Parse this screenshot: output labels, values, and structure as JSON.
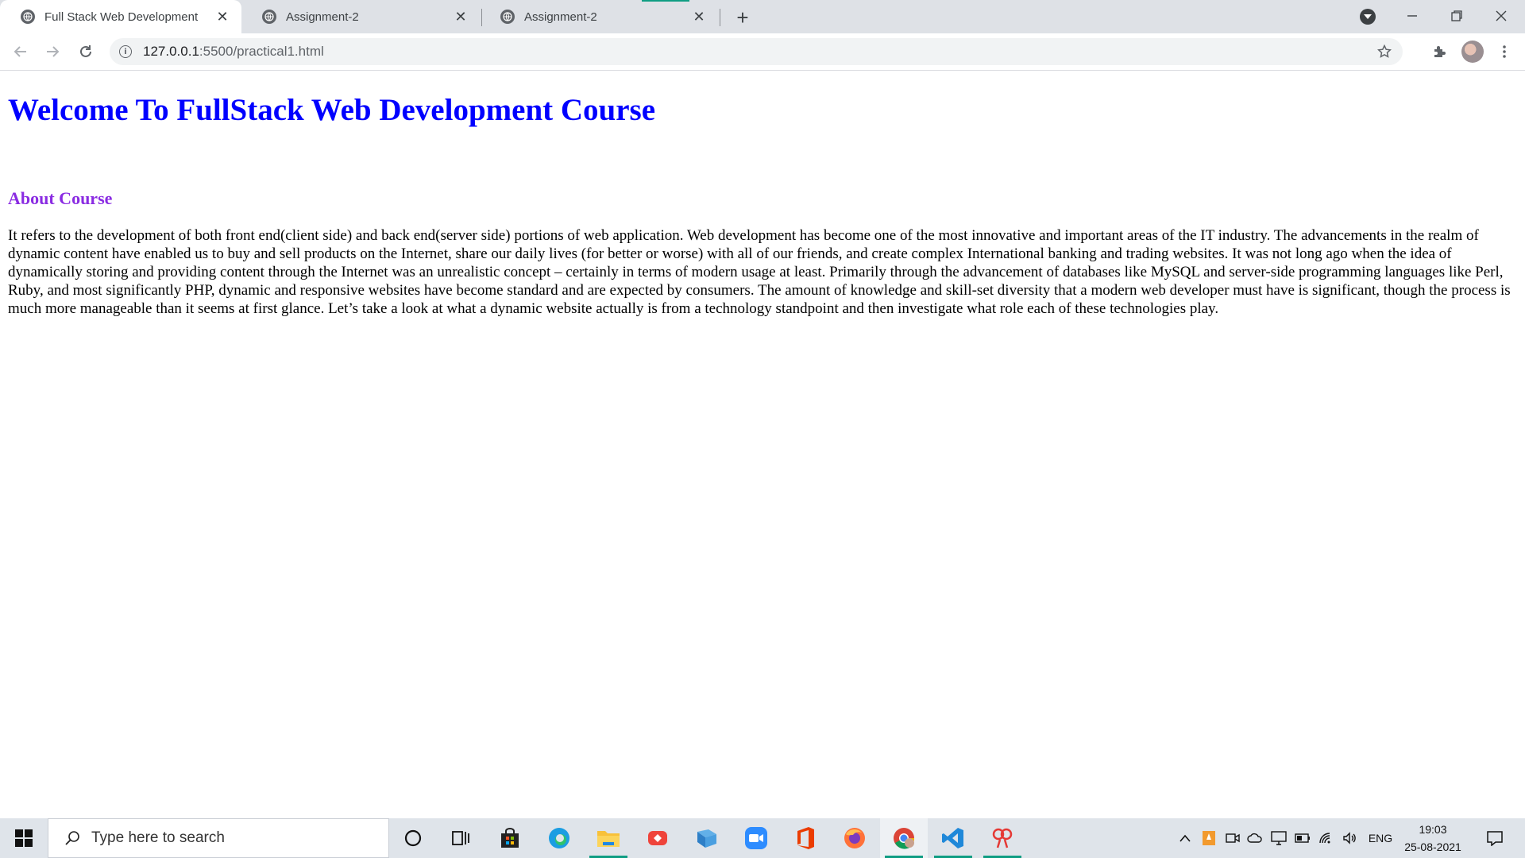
{
  "browser": {
    "tabs": [
      {
        "title": "Full Stack Web Development",
        "active": true
      },
      {
        "title": "Assignment-2",
        "active": false
      },
      {
        "title": "Assignment-2",
        "active": false
      }
    ],
    "new_tab_label": "+",
    "address": {
      "host": "127.0.0.1",
      "rest": ":5500/practical1.html"
    }
  },
  "page": {
    "heading": "Welcome To FullStack Web Development Course",
    "subheading": "About Course",
    "paragraph": "It refers to the development of both front end(client side) and back end(server side) portions of web application. Web development has become one of the most innovative and important areas of the IT industry. The advancements in the realm of dynamic content have enabled us to buy and sell products on the Internet, share our daily lives (for better or worse) with all of our friends, and create complex International banking and trading websites. It was not long ago when the idea of dynamically storing and providing content through the Internet was an unrealistic concept – certainly in terms of modern usage at least. Primarily through the advancement of databases like MySQL and server-side programming languages like Perl, Ruby, and most significantly PHP, dynamic and responsive websites have become standard and are expected by consumers. The amount of knowledge and skill-set diversity that a modern web developer must have is significant, though the process is much more manageable than it seems at first glance. Let’s take a look at what a dynamic website actually is from a technology standpoint and then investigate what role each of these technologies play.",
    "heading_color": "#0000ff",
    "subheading_color": "#8a2be2"
  },
  "taskbar": {
    "search_placeholder": "Type here to search",
    "apps": [
      "cortana-icon",
      "task-view-icon",
      "store-icon",
      "edge-icon",
      "file-explorer-icon",
      "anydesk-icon",
      "files-icon",
      "zoom-icon",
      "office-icon",
      "firefox-icon",
      "chrome-icon",
      "vscode-icon",
      "paint-icon"
    ],
    "language": "ENG",
    "time": "19:03",
    "date": "25-08-2021"
  }
}
